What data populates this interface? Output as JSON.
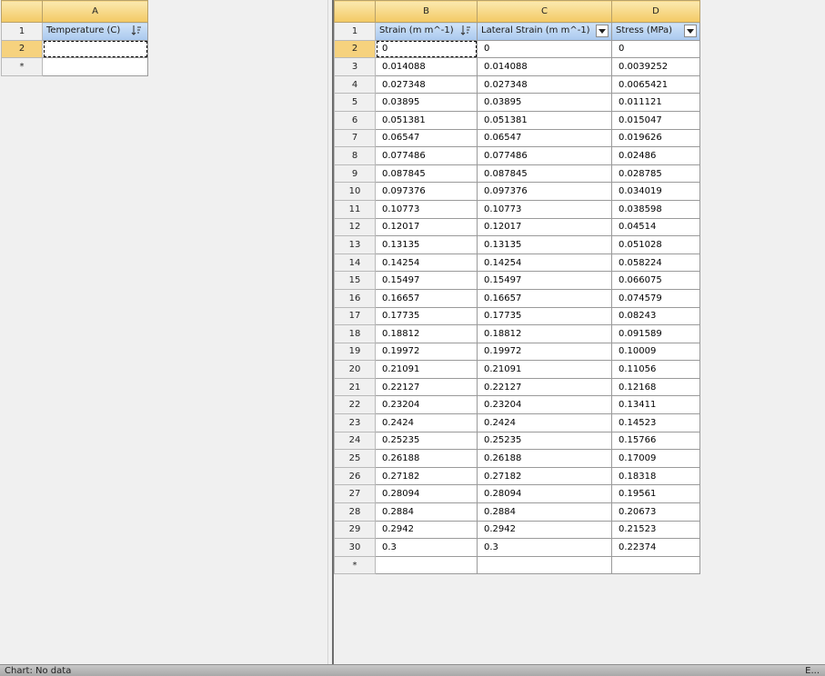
{
  "left_table": {
    "columns": [
      "A"
    ],
    "headers": [
      "Temperature (C)"
    ],
    "rows": [
      {
        "num": "1",
        "kind": "header"
      },
      {
        "num": "2",
        "kind": "data",
        "values": [
          ""
        ]
      },
      {
        "num": "*",
        "kind": "new",
        "values": [
          ""
        ]
      }
    ]
  },
  "right_table": {
    "columns": [
      "B",
      "C",
      "D"
    ],
    "headers": [
      "Strain (m m^-1)",
      "Lateral Strain (m m^-1)",
      "Stress (MPa)"
    ],
    "rows": [
      {
        "num": "2",
        "values": [
          "0",
          "0",
          "0"
        ]
      },
      {
        "num": "3",
        "values": [
          "0.014088",
          "0.014088",
          "0.0039252"
        ]
      },
      {
        "num": "4",
        "values": [
          "0.027348",
          "0.027348",
          "0.0065421"
        ]
      },
      {
        "num": "5",
        "values": [
          "0.03895",
          "0.03895",
          "0.011121"
        ]
      },
      {
        "num": "6",
        "values": [
          "0.051381",
          "0.051381",
          "0.015047"
        ]
      },
      {
        "num": "7",
        "values": [
          "0.06547",
          "0.06547",
          "0.019626"
        ]
      },
      {
        "num": "8",
        "values": [
          "0.077486",
          "0.077486",
          "0.02486"
        ]
      },
      {
        "num": "9",
        "values": [
          "0.087845",
          "0.087845",
          "0.028785"
        ]
      },
      {
        "num": "10",
        "values": [
          "0.097376",
          "0.097376",
          "0.034019"
        ]
      },
      {
        "num": "11",
        "values": [
          "0.10773",
          "0.10773",
          "0.038598"
        ]
      },
      {
        "num": "12",
        "values": [
          "0.12017",
          "0.12017",
          "0.04514"
        ]
      },
      {
        "num": "13",
        "values": [
          "0.13135",
          "0.13135",
          "0.051028"
        ]
      },
      {
        "num": "14",
        "values": [
          "0.14254",
          "0.14254",
          "0.058224"
        ]
      },
      {
        "num": "15",
        "values": [
          "0.15497",
          "0.15497",
          "0.066075"
        ]
      },
      {
        "num": "16",
        "values": [
          "0.16657",
          "0.16657",
          "0.074579"
        ]
      },
      {
        "num": "17",
        "values": [
          "0.17735",
          "0.17735",
          "0.08243"
        ]
      },
      {
        "num": "18",
        "values": [
          "0.18812",
          "0.18812",
          "0.091589"
        ]
      },
      {
        "num": "19",
        "values": [
          "0.19972",
          "0.19972",
          "0.10009"
        ]
      },
      {
        "num": "20",
        "values": [
          "0.21091",
          "0.21091",
          "0.11056"
        ]
      },
      {
        "num": "21",
        "values": [
          "0.22127",
          "0.22127",
          "0.12168"
        ]
      },
      {
        "num": "22",
        "values": [
          "0.23204",
          "0.23204",
          "0.13411"
        ]
      },
      {
        "num": "23",
        "values": [
          "0.2424",
          "0.2424",
          "0.14523"
        ]
      },
      {
        "num": "24",
        "values": [
          "0.25235",
          "0.25235",
          "0.15766"
        ]
      },
      {
        "num": "25",
        "values": [
          "0.26188",
          "0.26188",
          "0.17009"
        ]
      },
      {
        "num": "26",
        "values": [
          "0.27182",
          "0.27182",
          "0.18318"
        ]
      },
      {
        "num": "27",
        "values": [
          "0.28094",
          "0.28094",
          "0.19561"
        ]
      },
      {
        "num": "28",
        "values": [
          "0.2884",
          "0.2884",
          "0.20673"
        ]
      },
      {
        "num": "29",
        "values": [
          "0.2942",
          "0.2942",
          "0.21523"
        ]
      },
      {
        "num": "30",
        "values": [
          "0.3",
          "0.3",
          "0.22374"
        ]
      },
      {
        "num": "*",
        "values": [
          "",
          "",
          ""
        ]
      }
    ]
  },
  "header_row_num": "1",
  "icons": {
    "sort": "sort-icon",
    "dropdown": "dropdown-arrow-icon"
  },
  "colors": {
    "column_letter_bg": "#f3c964",
    "header_cell_bg": "#a9c8ee",
    "active_row_bg": "#f6d27e"
  },
  "statusbar": {
    "left": "Chart: No data",
    "right": "E..."
  }
}
